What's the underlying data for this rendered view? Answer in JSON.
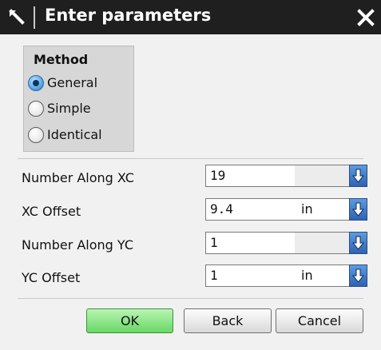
{
  "dialog": {
    "title": "Enter parameters",
    "pin_icon": "pin-icon",
    "close_icon": "close-icon"
  },
  "method": {
    "title": "Method",
    "options": [
      {
        "label": "General",
        "checked": true
      },
      {
        "label": "Simple",
        "checked": false
      },
      {
        "label": "Identical",
        "checked": false
      }
    ]
  },
  "fields": [
    {
      "label": "Number Along XC",
      "value": "19",
      "unit": ""
    },
    {
      "label": "XC Offset",
      "value": "9.4",
      "unit": "in"
    },
    {
      "label": "Number Along YC",
      "value": "1",
      "unit": ""
    },
    {
      "label": "YC Offset",
      "value": "1",
      "unit": "in"
    }
  ],
  "buttons": {
    "ok": "OK",
    "back": "Back",
    "cancel": "Cancel"
  },
  "colors": {
    "title_bar": "#1f1f1f",
    "ok_button": "#69d864",
    "dropdown_button": "#2e62b3",
    "radio_selected": "#5aa7e6"
  }
}
